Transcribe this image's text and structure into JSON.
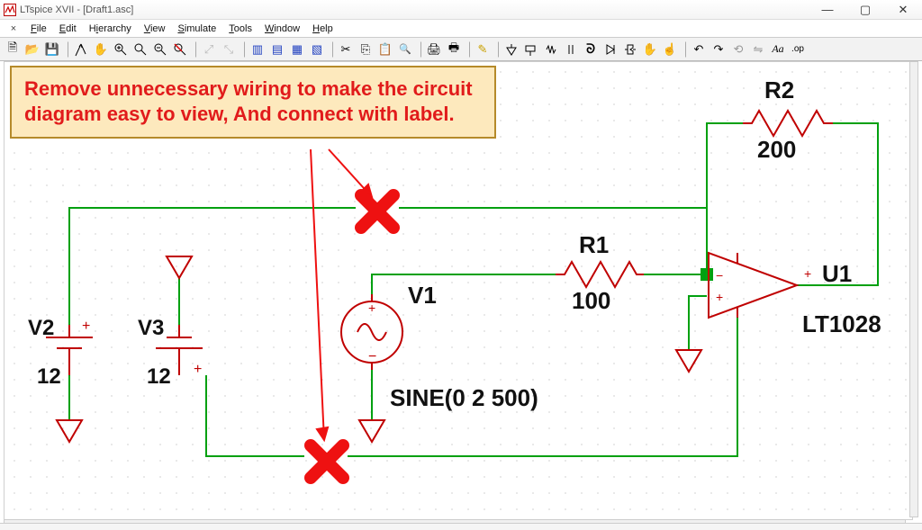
{
  "window": {
    "title": "LTspice XVII - [Draft1.asc]"
  },
  "menu": {
    "close_doc": "×",
    "items": [
      "File",
      "Edit",
      "Hierarchy",
      "View",
      "Simulate",
      "Tools",
      "Window",
      "Help"
    ]
  },
  "toolbar_icons": [
    "new",
    "open",
    "save",
    "sep",
    "run",
    "stop",
    "hand",
    "sep",
    "zoom-in",
    "zoom-auto",
    "zoom-out",
    "zoom-cancel",
    "sep",
    "pick1",
    "pick2",
    "sep",
    "tile1",
    "tile2",
    "tile3",
    "tile4",
    "sep",
    "cut",
    "copy",
    "paste",
    "find",
    "sep",
    "print",
    "setup",
    "sep",
    "pencil",
    "sep",
    "gnd",
    "netlabel",
    "resistor",
    "capacitor",
    "inductor",
    "diode",
    "component",
    "move",
    "rotate",
    "sep",
    "undo",
    "redo",
    "sep",
    "textAa",
    "op"
  ],
  "note_text": "Remove unnecessary wiring to make the circuit diagram easy to view, And connect with label.",
  "components": {
    "V2": {
      "name": "V2",
      "value": "12"
    },
    "V3": {
      "name": "V3",
      "value": "12"
    },
    "V1": {
      "name": "V1",
      "value": "SINE(0 2 500)"
    },
    "R1": {
      "name": "R1",
      "value": "100"
    },
    "R2": {
      "name": "R2",
      "value": "200"
    },
    "U1": {
      "name": "U1",
      "value": "LT1028"
    }
  }
}
